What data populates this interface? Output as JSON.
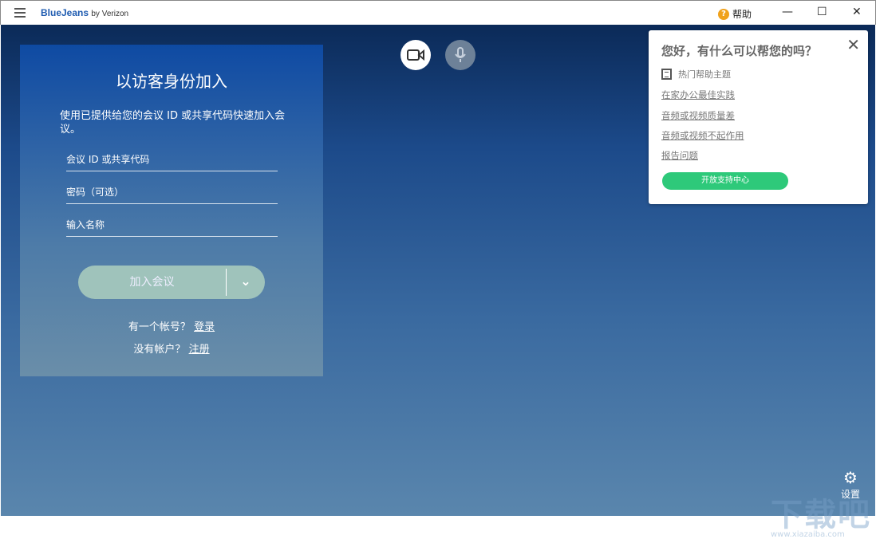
{
  "titlebar": {
    "logo": "BlueJeans",
    "logo_suffix": "by Verizon",
    "help": "帮助",
    "minimize": "—",
    "maximize": "☐",
    "close": "✕"
  },
  "join": {
    "title": "以访客身份加入",
    "description": "使用已提供给您的会议 ID 或共享代码快速加入会议。",
    "meeting_id_placeholder": "会议 ID 或共享代码",
    "passcode_placeholder": "密码（可选）",
    "name_placeholder": "输入名称",
    "join_button": "加入会议",
    "has_account": "有一个帐号？",
    "login": "登录",
    "no_account": "没有帐户？",
    "register": "注册"
  },
  "help_panel": {
    "title": "您好，有什么可以帮您的吗？",
    "section": "热门帮助主题",
    "links": [
      "在家办公最佳实践",
      "音频或视频质量差",
      "音频或视频不起作用",
      "报告问题"
    ],
    "button": "开放支持中心",
    "close": "✕"
  },
  "settings": {
    "label": "设置"
  },
  "watermark": {
    "text": "下载吧",
    "url": "www.xiazaiba.com"
  },
  "colors": {
    "accent_green": "#2ec97a",
    "join_button": "#9fc3bb",
    "brand": "#1e5bb0"
  }
}
